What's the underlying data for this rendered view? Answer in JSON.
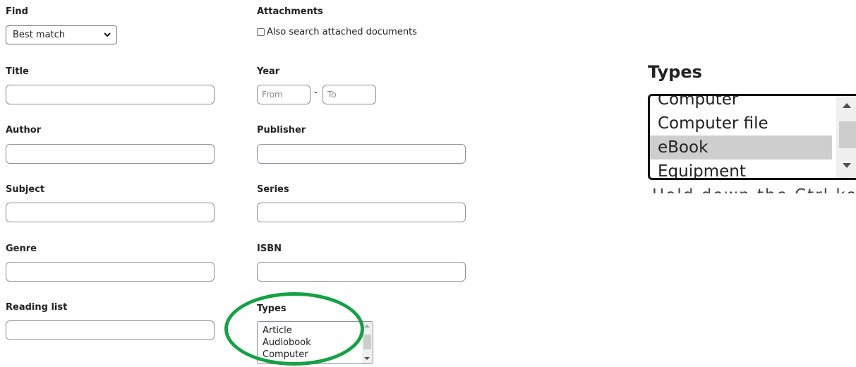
{
  "form": {
    "find": {
      "label": "Find",
      "selected": "Best match"
    },
    "attachments": {
      "label": "Attachments",
      "checkbox_label": "Also search attached documents",
      "checked": false
    },
    "title": {
      "label": "Title",
      "value": ""
    },
    "year": {
      "label": "Year",
      "from_placeholder": "From",
      "to_placeholder": "To",
      "separator": "-"
    },
    "author": {
      "label": "Author",
      "value": ""
    },
    "publisher": {
      "label": "Publisher",
      "value": ""
    },
    "subject": {
      "label": "Subject",
      "value": ""
    },
    "series": {
      "label": "Series",
      "value": ""
    },
    "genre": {
      "label": "Genre",
      "value": ""
    },
    "isbn": {
      "label": "ISBN",
      "value": ""
    },
    "reading_list": {
      "label": "Reading list",
      "value": ""
    },
    "types": {
      "label": "Types",
      "options": [
        "Article",
        "Audiobook",
        "Computer"
      ]
    }
  },
  "zoom": {
    "title": "Types",
    "options": [
      "Computer",
      "Computer file",
      "eBook",
      "Equipment"
    ],
    "selected": "eBook",
    "cut_hint": "Hold down the Ctrl key f"
  },
  "colors": {
    "highlight_oval": "#13a244",
    "selected_option_bg": "#cecece"
  },
  "icons": {
    "select_chevron": "chevron-down-icon",
    "scroll_up": "scroll-up-arrow-icon",
    "scroll_down": "scroll-down-arrow-icon"
  }
}
